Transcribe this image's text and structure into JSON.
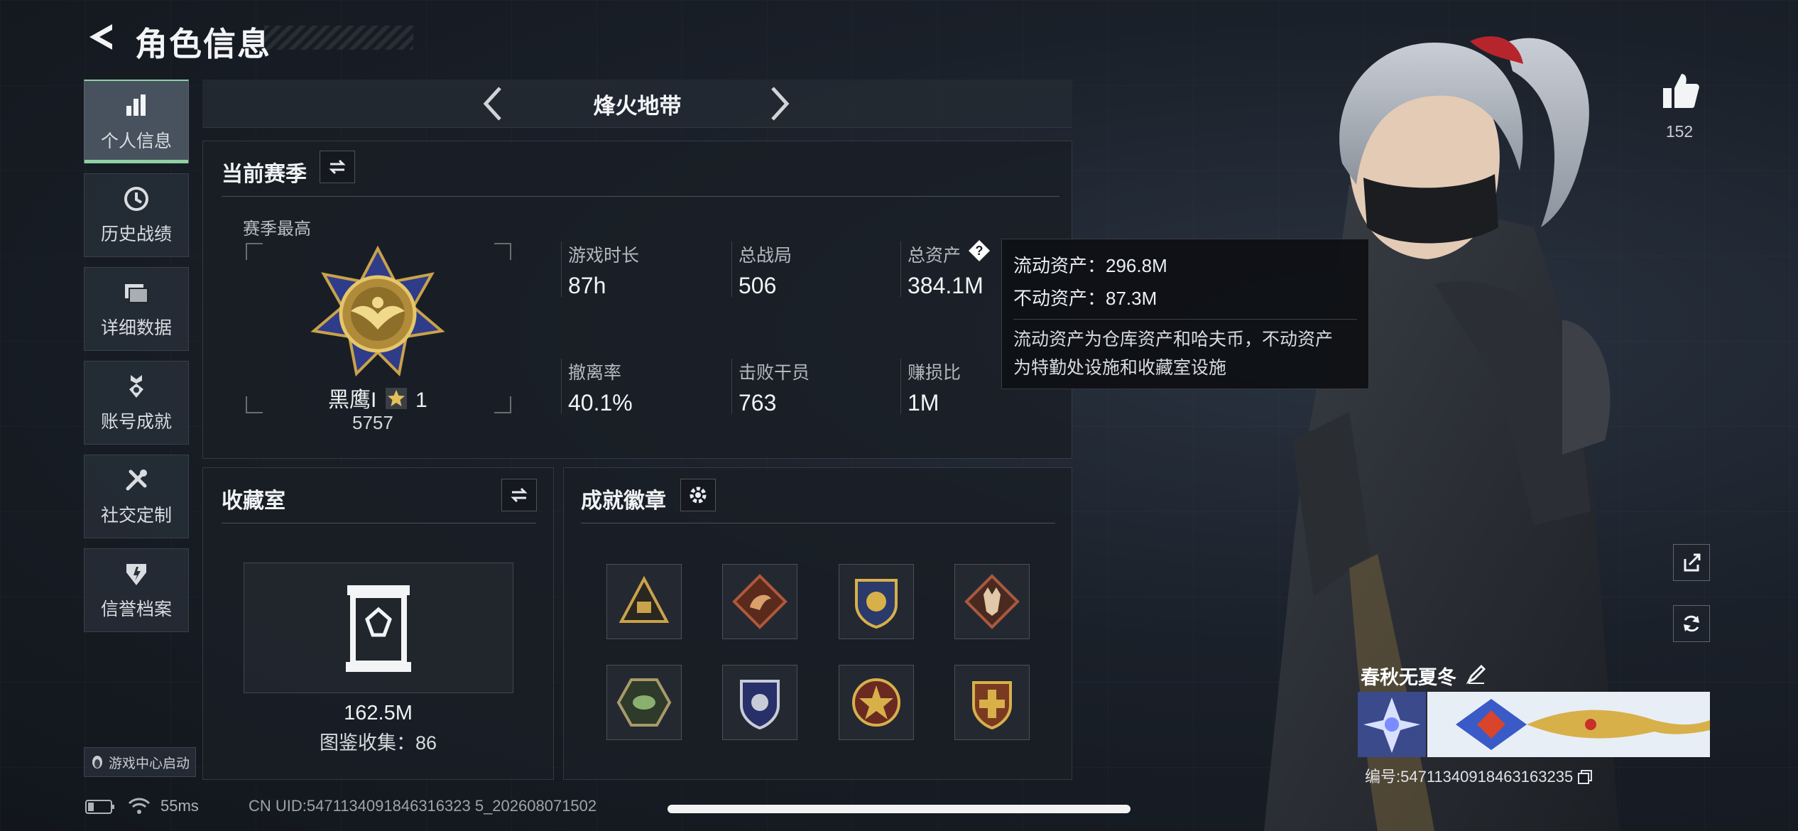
{
  "header": {
    "title": "角色信息"
  },
  "nav": [
    {
      "label": "个人信息",
      "icon": "bar-chart-icon",
      "active": true
    },
    {
      "label": "历史战绩",
      "icon": "clock-icon",
      "active": false
    },
    {
      "label": "详细数据",
      "icon": "folder-icon",
      "active": false
    },
    {
      "label": "账号成就",
      "icon": "medal-icon",
      "active": false
    },
    {
      "label": "社交定制",
      "icon": "tools-icon",
      "active": false
    },
    {
      "label": "信誉档案",
      "icon": "shield-icon",
      "active": false
    }
  ],
  "game_center": {
    "label": "游戏中心启动"
  },
  "mode": {
    "title": "烽火地带"
  },
  "season": {
    "title": "当前赛季",
    "best_label": "赛季最高",
    "rank_name": "黑鹰I",
    "rank_stars": "1",
    "rank_score": "5757",
    "stats": [
      {
        "label": "游戏时长",
        "value": "87h"
      },
      {
        "label": "总战局",
        "value": "506"
      },
      {
        "label": "总资产",
        "value": "384.1M"
      },
      {
        "label": "撤离率",
        "value": "40.1%"
      },
      {
        "label": "击败干员",
        "value": "763"
      },
      {
        "label": "赚损比",
        "value": "1M"
      }
    ]
  },
  "tooltip": {
    "liquid": "流动资产：296.8M",
    "fixed": "不动资产：87.3M",
    "desc_line1": "流动资产为仓库资产和哈夫币，不动资产",
    "desc_line2": "为特勤处设施和收藏室设施"
  },
  "collection": {
    "title": "收藏室",
    "value": "162.5M",
    "count": "图鉴收集：86"
  },
  "badges": {
    "title": "成就徽章",
    "items": [
      {
        "icon": "pyramid-badge-icon",
        "color": "#c9a24a"
      },
      {
        "icon": "dragon-badge-icon",
        "color": "#b0583a"
      },
      {
        "icon": "eagle-shield-badge-icon",
        "color": "#d8b04a"
      },
      {
        "icon": "wolf-badge-icon",
        "color": "#a85a3c"
      },
      {
        "icon": "hornet-badge-icon",
        "color": "#5e8a4e"
      },
      {
        "icon": "blue-shield-badge-icon",
        "color": "#4e5fa8"
      },
      {
        "icon": "star-emblem-badge-icon",
        "color": "#b84a3a"
      },
      {
        "icon": "cross-shield-badge-icon",
        "color": "#c8603a"
      }
    ]
  },
  "profile": {
    "likes": "152",
    "name": "春秋无夏冬",
    "id": "编号:5471134091846316323​5"
  },
  "status": {
    "latency": "55ms",
    "uid": "CN UID:5471134091846316323 5_202608071502"
  },
  "colors": {
    "accent": "#8fd0a4",
    "gold": "#c9a24a",
    "panel_bg": "#1a1f26"
  }
}
